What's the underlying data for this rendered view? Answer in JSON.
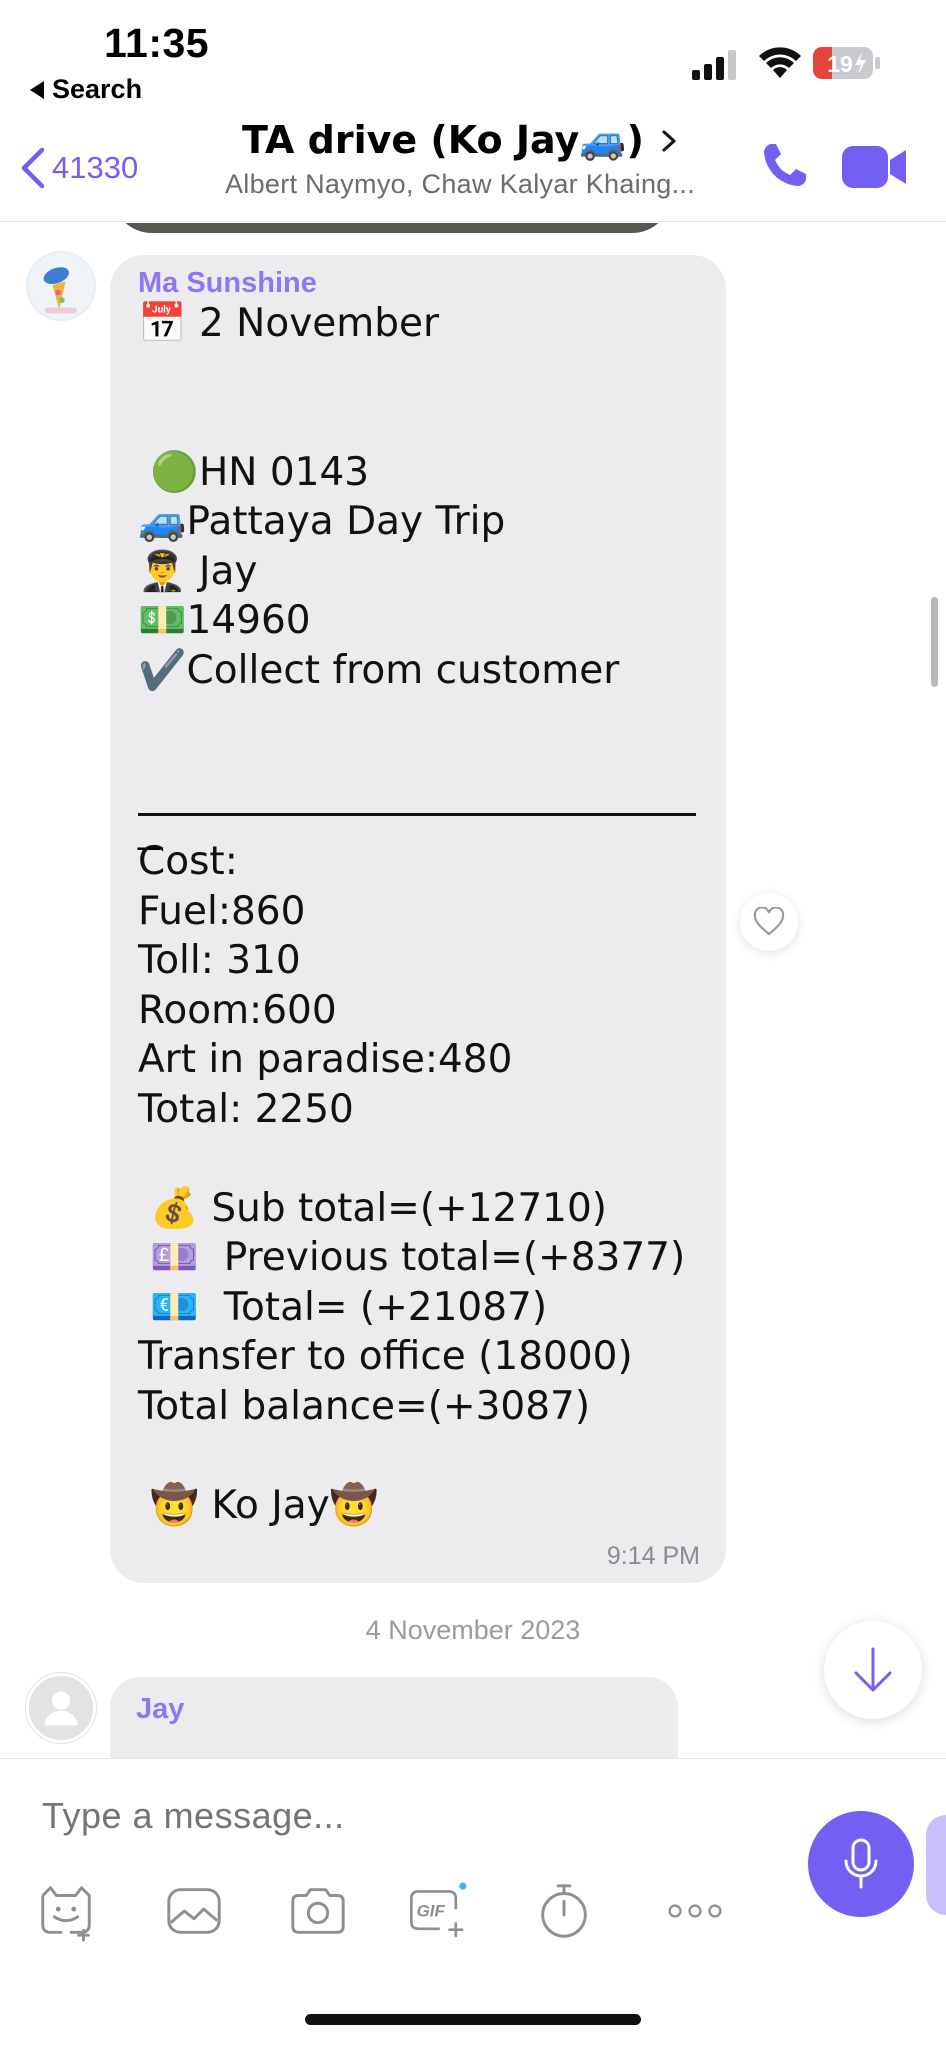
{
  "status_bar": {
    "time": "11:35",
    "back_app_label": "Search",
    "battery_level": "19"
  },
  "header": {
    "back_count": "41330",
    "title": "TA drive (Ko Jay🚙)",
    "subtitle": "Albert Naymyo, Chaw Kalyar Khaing..."
  },
  "message": {
    "sender": "Ma Sunshine",
    "lines_top": [
      "📅 2 November",
      "",
      "",
      " 🟢HN 0143",
      "🚙Pattaya Day Trip",
      "👨‍✈️ Jay",
      "💵14960",
      "✔️Collect from customer"
    ],
    "underscore_tail": "_",
    "cost_lines": [
      "Cost:",
      "Fuel:860",
      "Toll: 310",
      "Room:600",
      "Art in paradise:480",
      "Total: 2250",
      "",
      " 💰 Sub total=(+12710)",
      " 💷  Previous total=(+8377)",
      " 💶  Total= (+21087)",
      "Transfer to office (18000)",
      "Total balance=(+3087)",
      "",
      " 🤠 Ko Jay🤠"
    ],
    "time": "9:14 PM"
  },
  "date_separator": "4 November 2023",
  "next_message": {
    "sender": "Jay"
  },
  "composer": {
    "placeholder": "Type a message..."
  },
  "colors": {
    "accent": "#7360f2",
    "sender_name": "#8a78f4",
    "bubble_bg": "#ececee"
  },
  "icons": {
    "header": [
      "chevron-left-icon",
      "chevron-right-icon",
      "phone-icon",
      "video-camera-icon"
    ],
    "toolbar": [
      "sticker-icon",
      "gallery-icon",
      "camera-icon",
      "gif-icon",
      "timer-icon",
      "more-icon"
    ]
  }
}
